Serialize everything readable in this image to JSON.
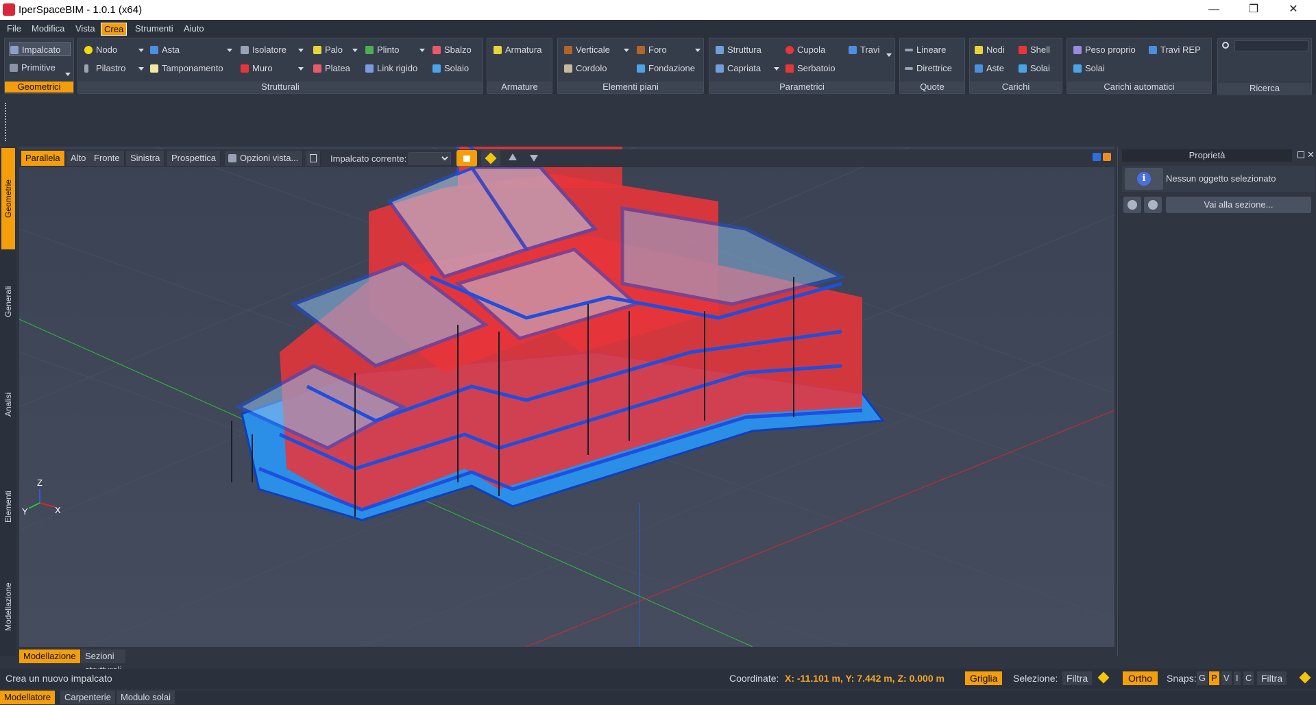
{
  "window": {
    "title": "IperSpaceBIM - 1.0.1 (x64)",
    "minimize": "—",
    "restore": "❐",
    "close": "✕"
  },
  "menu": [
    "File",
    "Modifica",
    "Vista",
    "Crea",
    "Strumenti",
    "Aiuto"
  ],
  "ribbon": {
    "geometrici": {
      "title": "Geometrici",
      "items": [
        "Impalcato",
        "Primitive"
      ]
    },
    "strutturali": {
      "title": "Strutturali",
      "items": [
        "Nodo",
        "Asta",
        "Isolatore",
        "Palo",
        "Plinto",
        "Sbalzo",
        "Pilastro",
        "Tamponamento",
        "Muro",
        "Platea",
        "Link rigido",
        "Solaio"
      ]
    },
    "armature": {
      "title": "Armature",
      "items": [
        "Armatura"
      ]
    },
    "elementi_piani": {
      "title": "Elementi piani",
      "items": [
        "Verticale",
        "Foro",
        "Cordolo",
        "Fondazione"
      ]
    },
    "parametrici": {
      "title": "Parametrici",
      "items": [
        "Struttura",
        "Cupola",
        "Travi",
        "Capriata",
        "Serbatoio"
      ]
    },
    "quote": {
      "title": "Quote",
      "items": [
        "Lineare",
        "Direttrice"
      ]
    },
    "carichi": {
      "title": "Carichi",
      "items": [
        "Nodi",
        "Shell",
        "Aste",
        "Solai"
      ]
    },
    "carichi_automatici": {
      "title": "Carichi automatici",
      "items": [
        "Peso proprio",
        "Travi REP",
        "Solai"
      ]
    },
    "ricerca": {
      "title": "Ricerca",
      "placeholder": ""
    }
  },
  "view_toolbar": {
    "views": [
      "Parallela",
      "Alto",
      "Fronte",
      "Sinistra",
      "Prospettica"
    ],
    "options": "Opzioni vista...",
    "current_level_label": "Impalcato corrente:",
    "current_level_value": ""
  },
  "left_tabs": [
    "Geometrie",
    "Generali",
    "Analisi",
    "Elementi",
    "Modellazione"
  ],
  "axes": {
    "x": "X",
    "y": "Y",
    "z": "Z"
  },
  "properties": {
    "title": "Proprietà",
    "no_selection": "Nessun oggetto selezionato",
    "goto_section": "Vai alla sezione..."
  },
  "bottom_tabs": [
    "Modellazione",
    "Sezioni strutturali"
  ],
  "status": {
    "message": "Crea un nuovo impalcato",
    "coord_label": "Coordinate:",
    "coord_value": "X: -11.101 m, Y: 7.442 m, Z: 0.000 m",
    "grid": "Griglia",
    "selection_label": "Selezione:",
    "filter": "Filtra",
    "ortho": "Ortho",
    "snaps_label": "Snaps:",
    "snaps": [
      "G",
      "P",
      "V",
      "I",
      "C"
    ],
    "snaps_filter": "Filtra"
  },
  "footer_tabs": [
    "Modellatore",
    "Carpenterie",
    "Modulo solai"
  ],
  "colors": {
    "accent": "#f59e0b",
    "wall_red": "#e8353a",
    "beam_blue": "#1d4fe0",
    "glass_blue": "#6aa8e8"
  }
}
